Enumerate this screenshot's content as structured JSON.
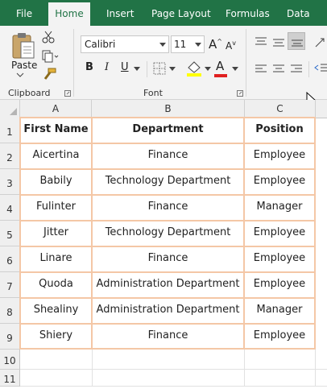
{
  "tabs": [
    "File",
    "Home",
    "Insert",
    "Page Layout",
    "Formulas",
    "Data"
  ],
  "ribbon": {
    "paste_label": "Paste",
    "font_name": "Calibri",
    "font_size": "11",
    "clipboard_label": "Clipboard",
    "font_label": "Font",
    "bold": "B",
    "italic": "I",
    "underline": "U",
    "grow_font": "A",
    "shrink_font": "A",
    "font_color_glyph": "A",
    "accent_highlight": "#ffff00",
    "accent_font_color": "#e02020"
  },
  "columns": [
    "A",
    "B",
    "C"
  ],
  "row_numbers": [
    "1",
    "2",
    "3",
    "4",
    "5",
    "6",
    "7",
    "8",
    "9",
    "10",
    "11"
  ],
  "table": {
    "headers": [
      "First Name",
      "Department",
      "Position"
    ],
    "rows": [
      [
        "Aicertina",
        "Finance",
        "Employee"
      ],
      [
        "Babily",
        "Technology Department",
        "Employee"
      ],
      [
        "Fulinter",
        "Finance",
        "Manager"
      ],
      [
        "Jitter",
        "Technology Department",
        "Employee"
      ],
      [
        "Linare",
        "Finance",
        "Employee"
      ],
      [
        "Quoda",
        "Administration Department",
        "Employee"
      ],
      [
        "Shealiny",
        "Administration Department",
        "Manager"
      ],
      [
        "Shiery",
        "Finance",
        "Employee"
      ]
    ]
  },
  "colors": {
    "brand": "#217346",
    "table_border": "#f4c7a6"
  }
}
